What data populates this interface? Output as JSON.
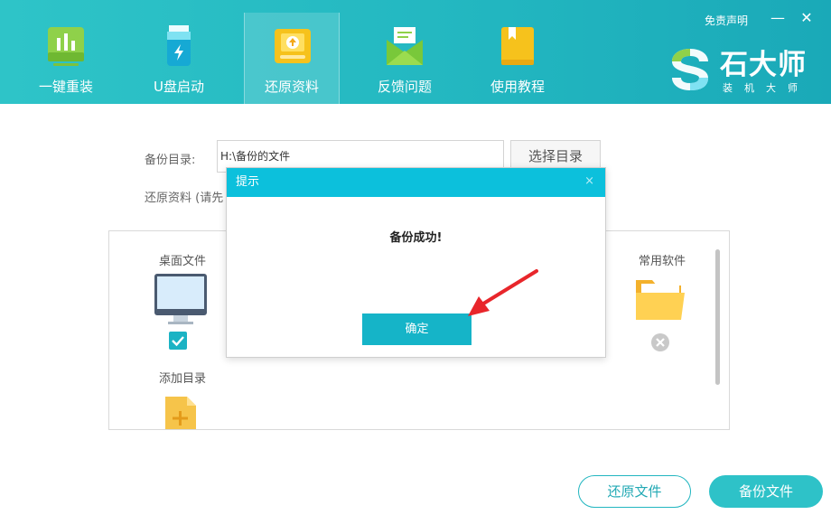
{
  "nav": {
    "items": [
      {
        "label": "一键重装",
        "icon": "bar-chart-icon"
      },
      {
        "label": "U盘启动",
        "icon": "usb-drive-icon"
      },
      {
        "label": "还原资料",
        "icon": "restore-icon",
        "active": true
      },
      {
        "label": "反馈问题",
        "icon": "envelope-icon"
      },
      {
        "label": "使用教程",
        "icon": "book-icon"
      }
    ]
  },
  "topbar": {
    "disclaimer": "免责声明",
    "minimize": "—",
    "close": "✕"
  },
  "brand": {
    "name": "石大师",
    "sub": "装机大师"
  },
  "backup": {
    "dir_label": "备份目录:",
    "dir_value": "H:\\备份的文件",
    "select_button": "选择目录",
    "restore_hint": "还原资料 (请先"
  },
  "files": {
    "items": [
      {
        "label": "桌面文件",
        "checked": true
      },
      {
        "label": "常用软件",
        "checked": false
      },
      {
        "label": "添加目录"
      }
    ]
  },
  "actions": {
    "restore_button": "还原文件",
    "backup_button": "备份文件"
  },
  "dialog": {
    "title": "提示",
    "close": "×",
    "message": "备份成功!",
    "ok_button": "确定"
  },
  "colors": {
    "header": "#22b6c0",
    "dialog_title": "#0cc0dc",
    "ok_button": "#15b4c8",
    "arrow": "#e8262b"
  }
}
